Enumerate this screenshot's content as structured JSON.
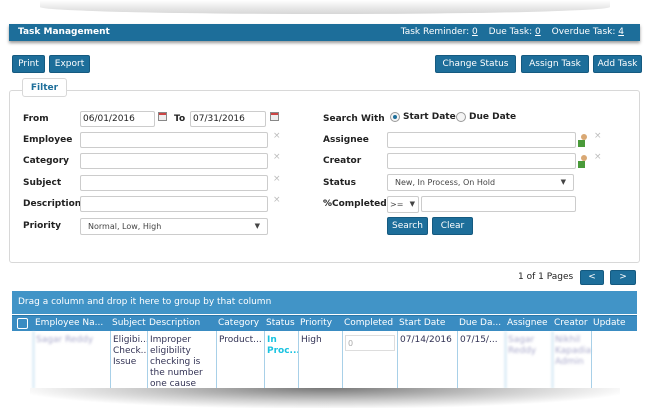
{
  "header": {
    "title": "Task Management",
    "task_reminder_label": "Task Reminder:",
    "task_reminder": "0",
    "due_task_label": "Due Task:",
    "due_task": "0",
    "overdue_task_label": "Overdue Task:",
    "overdue_task": "4"
  },
  "toolbar": {
    "print": "Print",
    "export": "Export",
    "change_status": "Change Status",
    "assign_task": "Assign Task",
    "add_task": "Add Task"
  },
  "filter": {
    "tab": "Filter",
    "from_label": "From",
    "from": "06/01/2016",
    "to_label": "To",
    "to": "07/31/2016",
    "employee_label": "Employee",
    "category_label": "Category",
    "subject_label": "Subject",
    "description_label": "Description",
    "priority_label": "Priority",
    "priority": "Normal, Low, High",
    "search_with_label": "Search With",
    "start_date": "Start Date",
    "due_date": "Due Date",
    "assignee_label": "Assignee",
    "creator_label": "Creator",
    "status_label": "Status",
    "status": "New, In Process, On Hold",
    "completed_label": "%Completed",
    "completed_op": ">=",
    "search": "Search",
    "clear": "Clear",
    "clear_icon": "×"
  },
  "pager": {
    "text": "1 of 1 Pages",
    "prev": "<",
    "next": ">"
  },
  "grid": {
    "group_hint": "Drag a column and drop it here to group by that column",
    "columns": [
      "Employee Na...",
      "Subject",
      "Description",
      "Category",
      "Status",
      "Priority",
      "Completed",
      "Start Date",
      "Due Da...",
      "Assignee",
      "Creator",
      "Update"
    ],
    "rows": [
      {
        "employee": "Sagar Reddy",
        "subject": "Eligibi... Check... Issue",
        "description": "Improper eligibility checking is the number one cause",
        "category": "Product...",
        "status": "In Proc...",
        "priority": "High",
        "completed": "0",
        "start": "07/14/2016",
        "due": "07/15/...",
        "assignee": "Sagar Reddy",
        "creator": "Nikhil Kapadia Admin",
        "update": ""
      }
    ]
  },
  "colors": {
    "accent": "#1d6e9a",
    "status_in_process": "#19c3e0"
  }
}
